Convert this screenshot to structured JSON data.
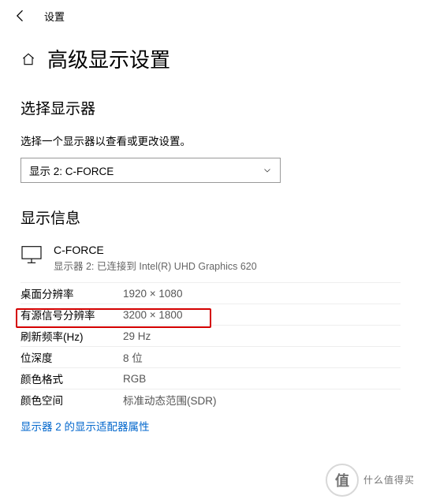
{
  "topbar": {
    "title": "设置"
  },
  "h1": "高级显示设置",
  "section_select": {
    "heading": "选择显示器",
    "desc": "选择一个显示器以查看或更改设置。",
    "dropdown_value": "显示 2: C-FORCE"
  },
  "section_info": {
    "heading": "显示信息",
    "device_name": "C-FORCE",
    "device_sub": "显示器 2: 已连接到 Intel(R) UHD Graphics 620",
    "rows": [
      {
        "label": "桌面分辨率",
        "value": "1920 × 1080"
      },
      {
        "label": "有源信号分辨率",
        "value": "3200 × 1800"
      },
      {
        "label": "刷新频率(Hz)",
        "value": "29 Hz"
      },
      {
        "label": "位深度",
        "value": "8 位"
      },
      {
        "label": "颜色格式",
        "value": "RGB"
      },
      {
        "label": "颜色空间",
        "value": "标准动态范围(SDR)"
      }
    ],
    "link": "显示器 2 的显示适配器属性"
  },
  "watermark": {
    "symbol": "值",
    "text": "什么值得买"
  }
}
